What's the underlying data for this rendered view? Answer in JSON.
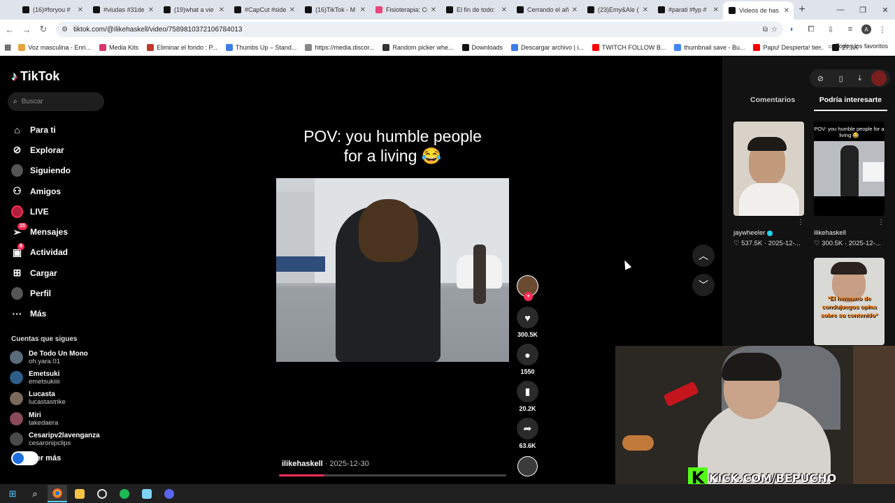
{
  "browser": {
    "tabs": [
      {
        "title": "(16)#foryou #",
        "active": false
      },
      {
        "title": "#viudas #31de",
        "active": false
      },
      {
        "title": "(19)what a vie",
        "active": false
      },
      {
        "title": "#CapCut #side",
        "active": false
      },
      {
        "title": "(16)TikTok - M",
        "active": false
      },
      {
        "title": "Fisioterapia: Cu",
        "active": false
      },
      {
        "title": "El fin de todo:",
        "active": false
      },
      {
        "title": "Cerrando el añ",
        "active": false
      },
      {
        "title": "(23)Emy&Ale (",
        "active": false
      },
      {
        "title": "#parati #fyp #",
        "active": false
      },
      {
        "title": "Videos de has",
        "active": true
      }
    ],
    "url": "tiktok.com/@ilikehaskell/video/7589810372106784013",
    "profile_initial": "A",
    "bookmarks": [
      "Voz masculina - Enri...",
      "Media Kits",
      "Eliminar el fondo : P...",
      "Thumbs Up – Stand...",
      "https://media.discor...",
      "Random picker whe...",
      "Downloads",
      "Descargar archivo | i...",
      "TWITCH FOLLOW B...",
      "thumbnail save - Bu...",
      "Papu! Despierta! tie...",
      "27.3K"
    ],
    "bookmarks_more": "»",
    "all_favorites": "Todos los favoritos"
  },
  "tiktok": {
    "logo": "TikTok",
    "search_placeholder": "Buscar",
    "nav": [
      {
        "label": "Para ti",
        "icon": "home-icon"
      },
      {
        "label": "Explorar",
        "icon": "compass-icon"
      },
      {
        "label": "Siguiendo",
        "icon": "following-avatar-icon"
      },
      {
        "label": "Amigos",
        "icon": "friends-icon"
      },
      {
        "label": "LIVE",
        "icon": "live-icon"
      },
      {
        "label": "Mensajes",
        "icon": "messages-icon",
        "badge": "15"
      },
      {
        "label": "Actividad",
        "icon": "activity-icon",
        "badge": "8"
      },
      {
        "label": "Cargar",
        "icon": "upload-icon"
      },
      {
        "label": "Perfil",
        "icon": "profile-icon"
      },
      {
        "label": "Más",
        "icon": "more-icon"
      }
    ],
    "following_title": "Cuentas que sigues",
    "accounts": [
      {
        "name": "De Todo Un Mono",
        "handle": "oh.yara.01"
      },
      {
        "name": "Emetsuki",
        "handle": "emetsukiiii"
      },
      {
        "name": "Lucasta",
        "handle": "lucastastrike"
      },
      {
        "name": "Miri",
        "handle": "takedaera"
      },
      {
        "name": "Cesaripv2lavenganza",
        "handle": "cesaronipclips"
      }
    ],
    "see_more": "Ver más",
    "video": {
      "caption_line1": "POV: you humble people",
      "caption_line2": "for a living 😂",
      "author": "ilikehaskell",
      "date": "· 2025-12-30",
      "progress": 0.2
    },
    "actions": {
      "likes": "300.5K",
      "comments": "1550",
      "saves": "20.2K",
      "shares": "63.6K"
    },
    "right_panel": {
      "tab_comments": "Comentarios",
      "tab_suggested": "Podría interesarte",
      "items": [
        {
          "author": "jaywheeler",
          "verified": true,
          "stats": "♡ 537.5K · 2025-12-..."
        },
        {
          "author": "ilikehaskell",
          "verified": false,
          "stats": "♡ 300.5K · 2025-12-...",
          "thumb_caption": "POV: you humble people for a living 😂"
        }
      ],
      "third_thumb_caption": "*El hermano de condujuegos opina sobre su contenido*"
    }
  },
  "overlay": {
    "kick_letter": "K",
    "kick_text": "KICK.COM/BEPUCHO"
  },
  "colors": {
    "tiktok_red": "#fe2c55",
    "kick_green": "#53fc18"
  }
}
